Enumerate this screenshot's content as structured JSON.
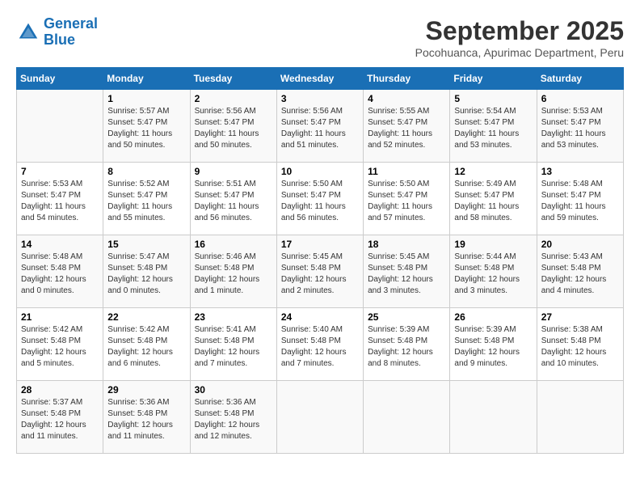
{
  "header": {
    "logo_line1": "General",
    "logo_line2": "Blue",
    "month": "September 2025",
    "location": "Pocohuanca, Apurimac Department, Peru"
  },
  "days_of_week": [
    "Sunday",
    "Monday",
    "Tuesday",
    "Wednesday",
    "Thursday",
    "Friday",
    "Saturday"
  ],
  "weeks": [
    [
      {
        "day": "",
        "detail": ""
      },
      {
        "day": "1",
        "detail": "Sunrise: 5:57 AM\nSunset: 5:47 PM\nDaylight: 11 hours\nand 50 minutes."
      },
      {
        "day": "2",
        "detail": "Sunrise: 5:56 AM\nSunset: 5:47 PM\nDaylight: 11 hours\nand 50 minutes."
      },
      {
        "day": "3",
        "detail": "Sunrise: 5:56 AM\nSunset: 5:47 PM\nDaylight: 11 hours\nand 51 minutes."
      },
      {
        "day": "4",
        "detail": "Sunrise: 5:55 AM\nSunset: 5:47 PM\nDaylight: 11 hours\nand 52 minutes."
      },
      {
        "day": "5",
        "detail": "Sunrise: 5:54 AM\nSunset: 5:47 PM\nDaylight: 11 hours\nand 53 minutes."
      },
      {
        "day": "6",
        "detail": "Sunrise: 5:53 AM\nSunset: 5:47 PM\nDaylight: 11 hours\nand 53 minutes."
      }
    ],
    [
      {
        "day": "7",
        "detail": "Sunrise: 5:53 AM\nSunset: 5:47 PM\nDaylight: 11 hours\nand 54 minutes."
      },
      {
        "day": "8",
        "detail": "Sunrise: 5:52 AM\nSunset: 5:47 PM\nDaylight: 11 hours\nand 55 minutes."
      },
      {
        "day": "9",
        "detail": "Sunrise: 5:51 AM\nSunset: 5:47 PM\nDaylight: 11 hours\nand 56 minutes."
      },
      {
        "day": "10",
        "detail": "Sunrise: 5:50 AM\nSunset: 5:47 PM\nDaylight: 11 hours\nand 56 minutes."
      },
      {
        "day": "11",
        "detail": "Sunrise: 5:50 AM\nSunset: 5:47 PM\nDaylight: 11 hours\nand 57 minutes."
      },
      {
        "day": "12",
        "detail": "Sunrise: 5:49 AM\nSunset: 5:47 PM\nDaylight: 11 hours\nand 58 minutes."
      },
      {
        "day": "13",
        "detail": "Sunrise: 5:48 AM\nSunset: 5:47 PM\nDaylight: 11 hours\nand 59 minutes."
      }
    ],
    [
      {
        "day": "14",
        "detail": "Sunrise: 5:48 AM\nSunset: 5:48 PM\nDaylight: 12 hours\nand 0 minutes."
      },
      {
        "day": "15",
        "detail": "Sunrise: 5:47 AM\nSunset: 5:48 PM\nDaylight: 12 hours\nand 0 minutes."
      },
      {
        "day": "16",
        "detail": "Sunrise: 5:46 AM\nSunset: 5:48 PM\nDaylight: 12 hours\nand 1 minute."
      },
      {
        "day": "17",
        "detail": "Sunrise: 5:45 AM\nSunset: 5:48 PM\nDaylight: 12 hours\nand 2 minutes."
      },
      {
        "day": "18",
        "detail": "Sunrise: 5:45 AM\nSunset: 5:48 PM\nDaylight: 12 hours\nand 3 minutes."
      },
      {
        "day": "19",
        "detail": "Sunrise: 5:44 AM\nSunset: 5:48 PM\nDaylight: 12 hours\nand 3 minutes."
      },
      {
        "day": "20",
        "detail": "Sunrise: 5:43 AM\nSunset: 5:48 PM\nDaylight: 12 hours\nand 4 minutes."
      }
    ],
    [
      {
        "day": "21",
        "detail": "Sunrise: 5:42 AM\nSunset: 5:48 PM\nDaylight: 12 hours\nand 5 minutes."
      },
      {
        "day": "22",
        "detail": "Sunrise: 5:42 AM\nSunset: 5:48 PM\nDaylight: 12 hours\nand 6 minutes."
      },
      {
        "day": "23",
        "detail": "Sunrise: 5:41 AM\nSunset: 5:48 PM\nDaylight: 12 hours\nand 7 minutes."
      },
      {
        "day": "24",
        "detail": "Sunrise: 5:40 AM\nSunset: 5:48 PM\nDaylight: 12 hours\nand 7 minutes."
      },
      {
        "day": "25",
        "detail": "Sunrise: 5:39 AM\nSunset: 5:48 PM\nDaylight: 12 hours\nand 8 minutes."
      },
      {
        "day": "26",
        "detail": "Sunrise: 5:39 AM\nSunset: 5:48 PM\nDaylight: 12 hours\nand 9 minutes."
      },
      {
        "day": "27",
        "detail": "Sunrise: 5:38 AM\nSunset: 5:48 PM\nDaylight: 12 hours\nand 10 minutes."
      }
    ],
    [
      {
        "day": "28",
        "detail": "Sunrise: 5:37 AM\nSunset: 5:48 PM\nDaylight: 12 hours\nand 11 minutes."
      },
      {
        "day": "29",
        "detail": "Sunrise: 5:36 AM\nSunset: 5:48 PM\nDaylight: 12 hours\nand 11 minutes."
      },
      {
        "day": "30",
        "detail": "Sunrise: 5:36 AM\nSunset: 5:48 PM\nDaylight: 12 hours\nand 12 minutes."
      },
      {
        "day": "",
        "detail": ""
      },
      {
        "day": "",
        "detail": ""
      },
      {
        "day": "",
        "detail": ""
      },
      {
        "day": "",
        "detail": ""
      }
    ]
  ]
}
